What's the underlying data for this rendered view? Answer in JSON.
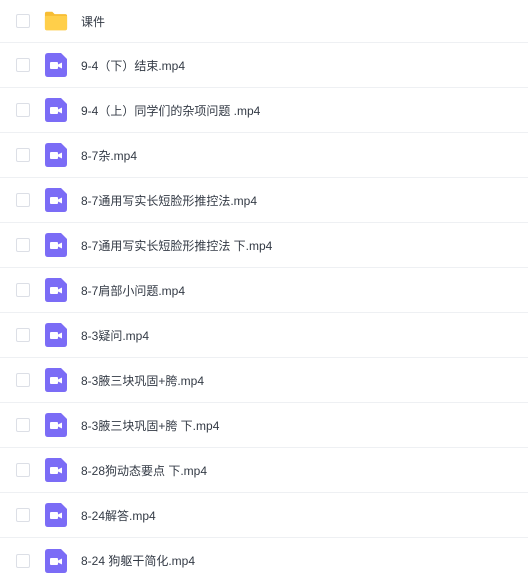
{
  "colors": {
    "folder": "#ffcf4a",
    "folder_tab": "#f7bd33",
    "video": "#7b6cf6",
    "video_glyph": "#ffffff",
    "text": "#333a45",
    "divider": "#eef0f3",
    "checkbox_border": "#dcdfe6"
  },
  "files": [
    {
      "name": "课件",
      "type": "folder",
      "icon": "folder-icon"
    },
    {
      "name": "9-4（下）结束.mp4",
      "type": "video",
      "icon": "video-file-icon"
    },
    {
      "name": "9-4（上）同学们的杂项问题 .mp4",
      "type": "video",
      "icon": "video-file-icon"
    },
    {
      "name": "8-7杂.mp4",
      "type": "video",
      "icon": "video-file-icon"
    },
    {
      "name": "8-7通用写实长短脸形推控法.mp4",
      "type": "video",
      "icon": "video-file-icon"
    },
    {
      "name": "8-7通用写实长短脸形推控法 下.mp4",
      "type": "video",
      "icon": "video-file-icon"
    },
    {
      "name": "8-7肩部小问题.mp4",
      "type": "video",
      "icon": "video-file-icon"
    },
    {
      "name": "8-3疑问.mp4",
      "type": "video",
      "icon": "video-file-icon"
    },
    {
      "name": "8-3腋三块巩固+胯.mp4",
      "type": "video",
      "icon": "video-file-icon"
    },
    {
      "name": "8-3腋三块巩固+胯 下.mp4",
      "type": "video",
      "icon": "video-file-icon"
    },
    {
      "name": "8-28狗动态要点 下.mp4",
      "type": "video",
      "icon": "video-file-icon"
    },
    {
      "name": "8-24解答.mp4",
      "type": "video",
      "icon": "video-file-icon"
    },
    {
      "name": "8-24 狗躯干简化.mp4",
      "type": "video",
      "icon": "video-file-icon"
    }
  ]
}
